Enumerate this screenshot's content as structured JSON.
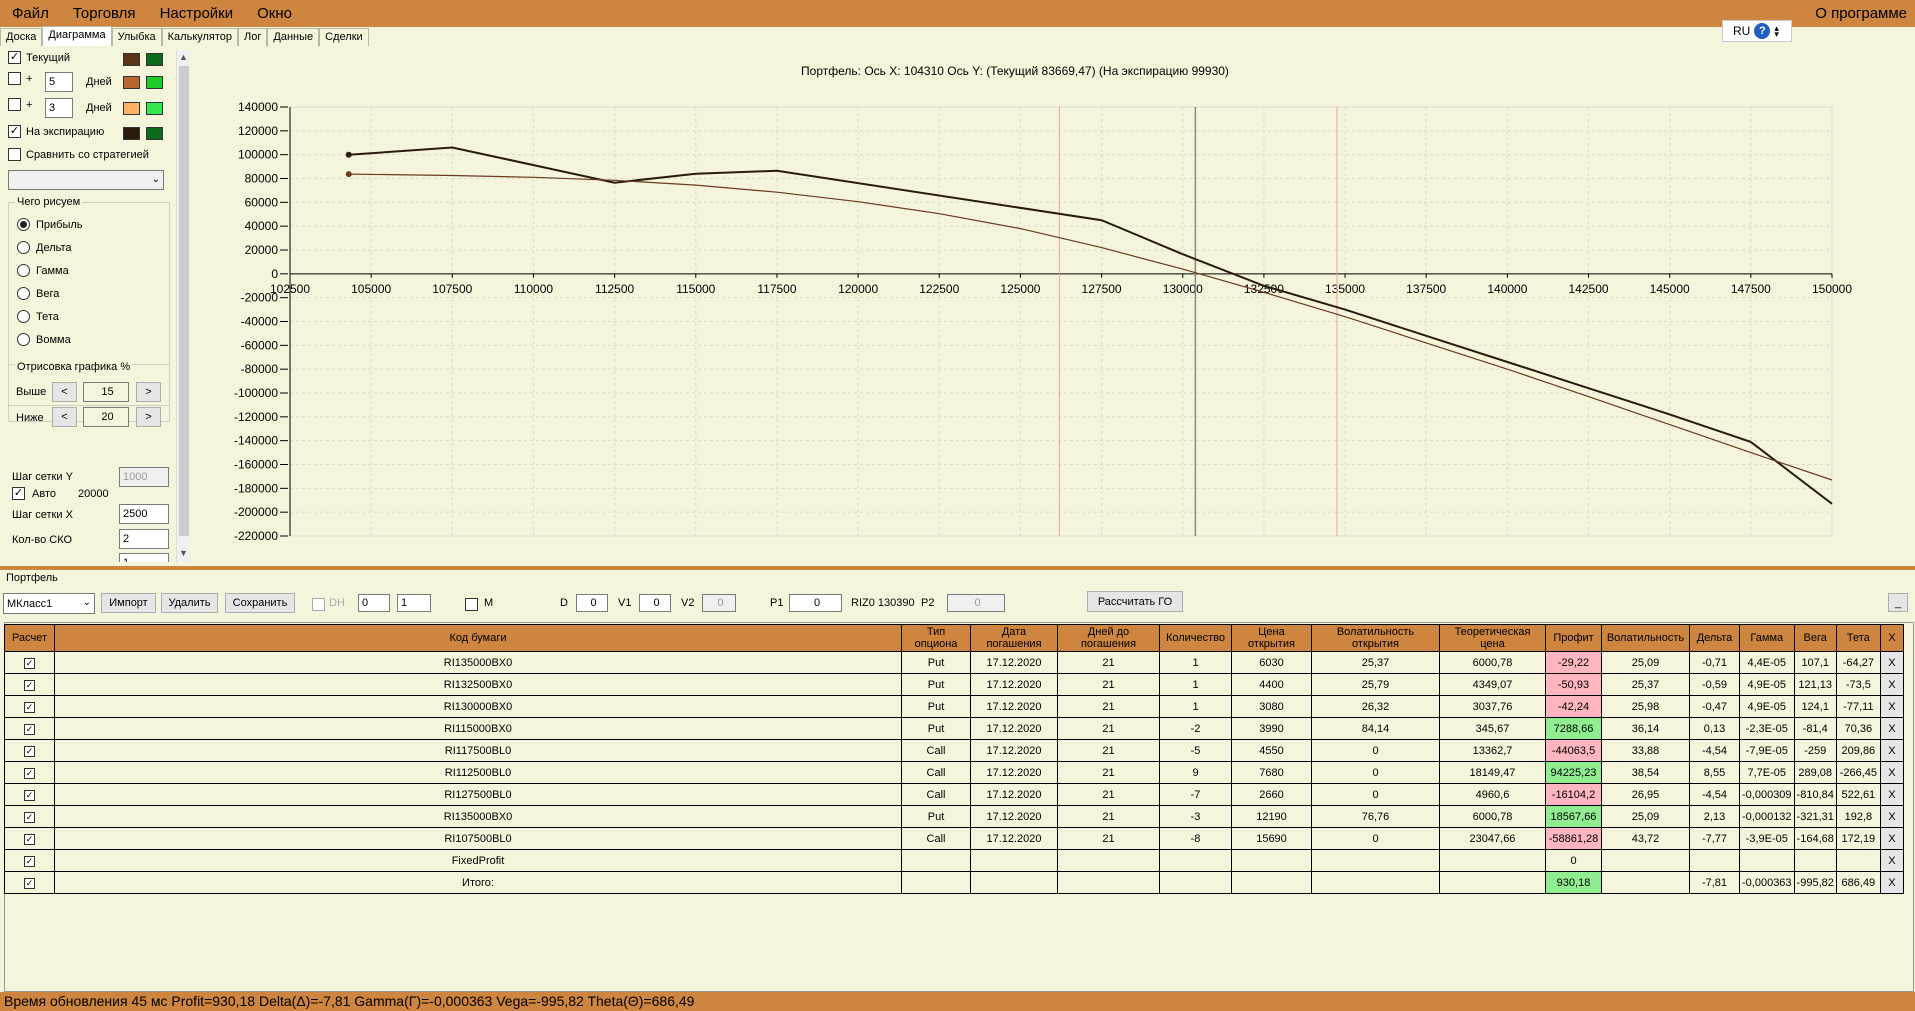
{
  "menu": {
    "items": [
      "Файл",
      "Торговля",
      "Настройки",
      "Окно"
    ],
    "about": "О программе"
  },
  "tabs": [
    "Доска",
    "Диаграмма",
    "Улыбка",
    "Калькулятор",
    "Лог",
    "Данные",
    "Сделки"
  ],
  "active_tab": "Диаграмма",
  "lang": {
    "code": "RU",
    "help": "?"
  },
  "left": {
    "current_label": "Текущий",
    "plus": "+",
    "days1": "5",
    "days2": "3",
    "days_label": "Дней",
    "expiry_label": "На экспирацию",
    "compare_label": "Сравнить со стратегией",
    "draw_group": "Чего рисуем",
    "draw_options": [
      "Прибыль",
      "Дельта",
      "Гамма",
      "Вега",
      "Тета",
      "Вомма"
    ],
    "render_group": "Отрисовка графика %",
    "above_label": "Выше",
    "above_value": "15",
    "below_label": "Ниже",
    "below_value": "20",
    "btn_less": "<",
    "btn_more": ">",
    "grid_y_label": "Шаг сетки Y",
    "grid_y_value": "1000",
    "auto_label": "Авто",
    "auto_value": "20000",
    "grid_x_label": "Шаг сетки X",
    "grid_x_value": "2500",
    "sko_label": "Кол-во СКО",
    "sko_value": "2",
    "next_value": "1",
    "colors": {
      "current": [
        "#5C3317",
        "#0B6B1A"
      ],
      "d5": [
        "#B8652E",
        "#1FCC2A"
      ],
      "d3": [
        "#FFB266",
        "#33E64C"
      ],
      "exp": [
        "#2B1A0E",
        "#0B6B1A"
      ]
    }
  },
  "chart_title": "Портфель: Ось X: 104310 Ось Y:  (Текущий 83669,47)  (На экспирацию 99930)",
  "chart_data": {
    "type": "line",
    "xlim": [
      102500,
      150000
    ],
    "ylim": [
      -220000,
      140000
    ],
    "x_ticks": [
      102500,
      105000,
      107500,
      110000,
      112500,
      115000,
      117500,
      120000,
      122500,
      125000,
      127500,
      130000,
      132500,
      135000,
      137500,
      140000,
      142500,
      145000,
      147500,
      150000
    ],
    "y_ticks": [
      140000,
      120000,
      100000,
      80000,
      60000,
      40000,
      20000,
      0,
      -20000,
      -40000,
      -60000,
      -80000,
      -100000,
      -120000,
      -140000,
      -160000,
      -180000,
      -200000,
      -220000
    ],
    "vlines": {
      "current": 130390,
      "sko_low": 126200,
      "sko_high": 134750
    },
    "series": [
      {
        "key": "expiration",
        "color": "#2B1A0E",
        "points": [
          [
            104310,
            99930
          ],
          [
            107500,
            106000
          ],
          [
            112500,
            76500
          ],
          [
            115000,
            84000
          ],
          [
            117500,
            86500
          ],
          [
            127500,
            45000
          ],
          [
            130000,
            16500
          ],
          [
            132500,
            -10000
          ],
          [
            135000,
            -30000
          ],
          [
            137500,
            -52000
          ],
          [
            140000,
            -74000
          ],
          [
            142500,
            -96000
          ],
          [
            145000,
            -118000
          ],
          [
            147500,
            -141000
          ],
          [
            150000,
            -193000
          ]
        ]
      },
      {
        "key": "current",
        "color": "#6B3A1F",
        "points": [
          [
            104310,
            83669
          ],
          [
            107500,
            82500
          ],
          [
            110000,
            81000
          ],
          [
            112500,
            78500
          ],
          [
            115000,
            74500
          ],
          [
            117500,
            68500
          ],
          [
            120000,
            60500
          ],
          [
            122500,
            50500
          ],
          [
            125000,
            38000
          ],
          [
            127500,
            22000
          ],
          [
            130000,
            4000
          ],
          [
            132500,
            -15500
          ],
          [
            135000,
            -36000
          ],
          [
            137500,
            -58000
          ],
          [
            140000,
            -80000
          ],
          [
            142500,
            -103000
          ],
          [
            145000,
            -126500
          ],
          [
            147500,
            -150000
          ],
          [
            150000,
            -173000
          ]
        ]
      }
    ]
  },
  "portfolio": {
    "label": "Портфель",
    "select": "МКласс1",
    "import": "Импорт",
    "delete": "Удалить",
    "save": "Сохранить",
    "dh_label": "DH",
    "dh_v1": "0",
    "dh_v2": "1",
    "m_label": "M",
    "d_label": "D",
    "d_value": "0",
    "v1_label": "V1",
    "v1_value": "0",
    "v2_label": "V2",
    "v2_value": "0",
    "p1_label": "P1",
    "p1_value": "0",
    "instrument": "RIZ0 130390",
    "p2_label": "P2",
    "p2_value": "0",
    "calc_button": "Рассчитать ГО",
    "minimize": "_"
  },
  "table": {
    "columns": [
      "Расчет",
      "Код бумаги",
      "Тип опциона",
      "Дата погашения",
      "Дней до погашения",
      "Количество",
      "Цена открытия",
      "Волатильность открытия",
      "Теоретическая цена",
      "Профит",
      "Волатильность",
      "Дельта",
      "Гамма",
      "Вега",
      "Тета",
      "X"
    ],
    "rows": [
      {
        "code": "RI135000BX0",
        "type": "Put",
        "date": "17.12.2020",
        "days": "21",
        "qty": "1",
        "open": "6030",
        "vol_open": "25,37",
        "theor": "6000,78",
        "profit": "-29,22",
        "pc": "red",
        "vol": "25,09",
        "delta": "-0,71",
        "gamma": "4,4E-05",
        "vega": "107,1",
        "theta": "-64,27"
      },
      {
        "code": "RI132500BX0",
        "type": "Put",
        "date": "17.12.2020",
        "days": "21",
        "qty": "1",
        "open": "4400",
        "vol_open": "25,79",
        "theor": "4349,07",
        "profit": "-50,93",
        "pc": "red",
        "vol": "25,37",
        "delta": "-0,59",
        "gamma": "4,9E-05",
        "vega": "121,13",
        "theta": "-73,5"
      },
      {
        "code": "RI130000BX0",
        "type": "Put",
        "date": "17.12.2020",
        "days": "21",
        "qty": "1",
        "open": "3080",
        "vol_open": "26,32",
        "theor": "3037,76",
        "profit": "-42,24",
        "pc": "red",
        "vol": "25,98",
        "delta": "-0,47",
        "gamma": "4,9E-05",
        "vega": "124,1",
        "theta": "-77,11"
      },
      {
        "code": "RI115000BX0",
        "type": "Put",
        "date": "17.12.2020",
        "days": "21",
        "qty": "-2",
        "open": "3990",
        "vol_open": "84,14",
        "theor": "345,67",
        "profit": "7288,66",
        "pc": "green",
        "vol": "36,14",
        "delta": "0,13",
        "gamma": "-2,3E-05",
        "vega": "-81,4",
        "theta": "70,36"
      },
      {
        "code": "RI117500BL0",
        "type": "Call",
        "date": "17.12.2020",
        "days": "21",
        "qty": "-5",
        "open": "4550",
        "vol_open": "0",
        "theor": "13362,7",
        "profit": "-44063,5",
        "pc": "red",
        "vol": "33,88",
        "delta": "-4,54",
        "gamma": "-7,9E-05",
        "vega": "-259",
        "theta": "209,86"
      },
      {
        "code": "RI112500BL0",
        "type": "Call",
        "date": "17.12.2020",
        "days": "21",
        "qty": "9",
        "open": "7680",
        "vol_open": "0",
        "theor": "18149,47",
        "profit": "94225,23",
        "pc": "green",
        "vol": "38,54",
        "delta": "8,55",
        "gamma": "7,7E-05",
        "vega": "289,08",
        "theta": "-266,45"
      },
      {
        "code": "RI127500BL0",
        "type": "Call",
        "date": "17.12.2020",
        "days": "21",
        "qty": "-7",
        "open": "2660",
        "vol_open": "0",
        "theor": "4960,6",
        "profit": "-16104,2",
        "pc": "red",
        "vol": "26,95",
        "delta": "-4,54",
        "gamma": "-0,000309",
        "vega": "-810,84",
        "theta": "522,61"
      },
      {
        "code": "RI135000BX0",
        "type": "Put",
        "date": "17.12.2020",
        "days": "21",
        "qty": "-3",
        "open": "12190",
        "vol_open": "76,76",
        "theor": "6000,78",
        "profit": "18567,66",
        "pc": "green",
        "vol": "25,09",
        "delta": "2,13",
        "gamma": "-0,000132",
        "vega": "-321,31",
        "theta": "192,8"
      },
      {
        "code": "RI107500BL0",
        "type": "Call",
        "date": "17.12.2020",
        "days": "21",
        "qty": "-8",
        "open": "15690",
        "vol_open": "0",
        "theor": "23047,66",
        "profit": "-58861,28",
        "pc": "red",
        "vol": "43,72",
        "delta": "-7,77",
        "gamma": "-3,9E-05",
        "vega": "-164,68",
        "theta": "172,19"
      },
      {
        "code": "FixedProfit",
        "type": "",
        "date": "",
        "days": "",
        "qty": "",
        "open": "",
        "vol_open": "",
        "theor": "",
        "profit": "0",
        "pc": "",
        "vol": "",
        "delta": "",
        "gamma": "",
        "vega": "",
        "theta": ""
      },
      {
        "code": "Итого:",
        "type": "",
        "date": "",
        "days": "",
        "qty": "",
        "open": "",
        "vol_open": "",
        "theor": "",
        "profit": "930,18",
        "pc": "green",
        "vol": "",
        "delta": "-7,81",
        "gamma": "-0,000363",
        "vega": "-995,82",
        "theta": "686,49"
      }
    ],
    "x_label": "X"
  },
  "status": "Время обновления 45 мс  Profit=930,18 Delta(Δ)=-7,81 Gamma(Γ)=-0,000363 Vega=-995,82 Theta(Θ)=686,49"
}
